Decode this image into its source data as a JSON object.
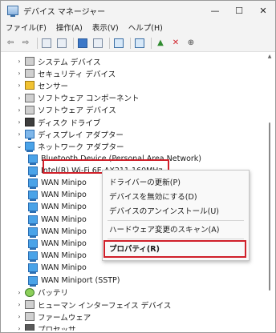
{
  "window": {
    "title": "デバイス マネージャー",
    "controls": {
      "minimize": "—",
      "maximize": "☐",
      "close": "✕"
    }
  },
  "menubar": {
    "items": [
      "ファイル(F)",
      "操作(A)",
      "表示(V)",
      "ヘルプ(H)"
    ]
  },
  "tree": {
    "items": [
      {
        "chev": "›",
        "label": "システム デバイス",
        "icon": "gray"
      },
      {
        "chev": "›",
        "label": "セキュリティ デバイス",
        "icon": "gray"
      },
      {
        "chev": "›",
        "label": "センサー",
        "icon": "yellow"
      },
      {
        "chev": "›",
        "label": "ソフトウェア コンポーネント",
        "icon": "gray"
      },
      {
        "chev": "›",
        "label": "ソフトウェア デバイス",
        "icon": "gray"
      },
      {
        "chev": "›",
        "label": "ディスク ドライブ",
        "icon": "dark"
      },
      {
        "chev": "›",
        "label": "ディスプレイ アダプター",
        "icon": "monitor"
      },
      {
        "chev": "⌄",
        "label": "ネットワーク アダプター",
        "icon": "net"
      },
      {
        "chev": "",
        "label": "Bluetooth Device (Personal Area Network)",
        "icon": "net",
        "child": true
      },
      {
        "chev": "",
        "label": "Intel(R) Wi-Fi 6E AX211 160MHz",
        "icon": "net",
        "child": true,
        "selected": true
      },
      {
        "chev": "",
        "label": "WAN Minipo",
        "icon": "net",
        "child": true
      },
      {
        "chev": "",
        "label": "WAN Minipo",
        "icon": "net",
        "child": true
      },
      {
        "chev": "",
        "label": "WAN Minipo",
        "icon": "net",
        "child": true
      },
      {
        "chev": "",
        "label": "WAN Minipo",
        "icon": "net",
        "child": true
      },
      {
        "chev": "",
        "label": "WAN Minipo",
        "icon": "net",
        "child": true
      },
      {
        "chev": "",
        "label": "WAN Minipo",
        "icon": "net",
        "child": true
      },
      {
        "chev": "",
        "label": "WAN Minipo",
        "icon": "net",
        "child": true
      },
      {
        "chev": "",
        "label": "WAN Minipo",
        "icon": "net",
        "child": true
      },
      {
        "chev": "",
        "label": "WAN Miniport (SSTP)",
        "icon": "net",
        "child": true
      },
      {
        "chev": "›",
        "label": "バッテリ",
        "icon": "green"
      },
      {
        "chev": "›",
        "label": "ヒューマン インターフェイス デバイス",
        "icon": "gray"
      },
      {
        "chev": "›",
        "label": "ファームウェア",
        "icon": "gray"
      },
      {
        "chev": "›",
        "label": "プロセッサ",
        "icon": "chip"
      }
    ]
  },
  "context_menu": {
    "update_driver": "ドライバーの更新(P)",
    "disable_device": "デバイスを無効にする(D)",
    "uninstall_device": "デバイスのアンインストール(U)",
    "scan_hardware": "ハードウェア変更のスキャン(A)",
    "properties": "プロパティ(R)"
  },
  "colors": {
    "highlight_box": "#d0202a",
    "accent": "#2c6fb3"
  }
}
